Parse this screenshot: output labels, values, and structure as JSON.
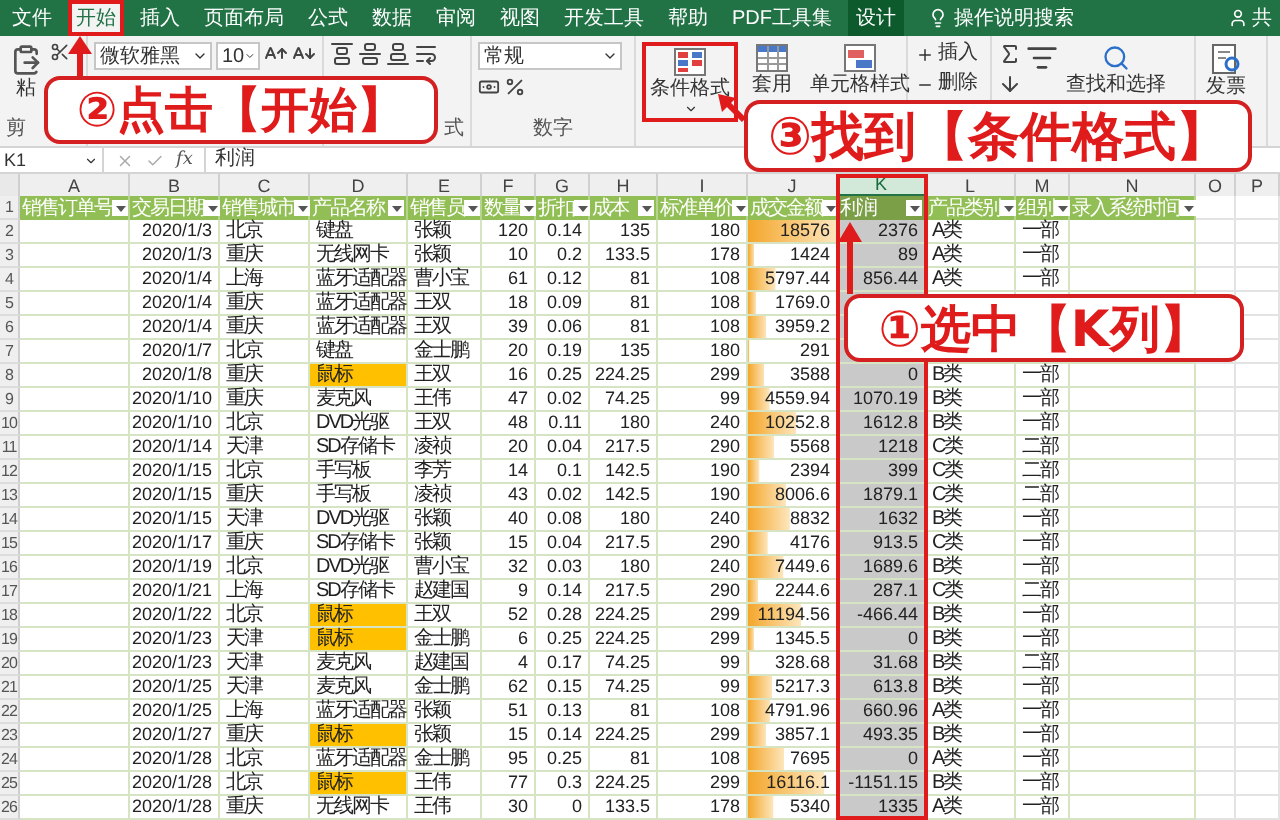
{
  "ribbon_tabs": [
    {
      "label": "文件",
      "kind": "tab",
      "selected": false
    },
    {
      "label": "开始",
      "kind": "tab",
      "selected": true
    },
    {
      "label": "插入",
      "kind": "tab",
      "selected": false
    },
    {
      "label": "页面布局",
      "kind": "tab",
      "selected": false
    },
    {
      "label": "公式",
      "kind": "tab",
      "selected": false
    },
    {
      "label": "数据",
      "kind": "tab",
      "selected": false
    },
    {
      "label": "审阅",
      "kind": "tab",
      "selected": false
    },
    {
      "label": "视图",
      "kind": "tab",
      "selected": false
    },
    {
      "label": "开发工具",
      "kind": "tab",
      "selected": false
    },
    {
      "label": "帮助",
      "kind": "tab",
      "selected": false
    },
    {
      "label": "PDF工具集",
      "kind": "tab",
      "selected": false
    },
    {
      "label": "设计",
      "kind": "context",
      "selected": false
    }
  ],
  "tell_me": "操作说明搜索",
  "share": "共",
  "ribbon": {
    "paste": "粘",
    "clipboard_group": "剪",
    "font_name": "微软雅黑",
    "font_size": "10",
    "alignment_group": "式",
    "number_format": "常规",
    "number_group": "数字",
    "conditional_format": "条件格式",
    "format_as_table": "套用",
    "cell_styles": "单元格样式",
    "insert": "插入",
    "delete": "删除",
    "find_select": "查找和选择",
    "invoice": "发票"
  },
  "formula_bar": {
    "name_box": "K1",
    "fx": "fx",
    "formula": "利润"
  },
  "columns": [
    {
      "label": "A",
      "selected": false
    },
    {
      "label": "B",
      "selected": false
    },
    {
      "label": "C",
      "selected": false
    },
    {
      "label": "D",
      "selected": false
    },
    {
      "label": "E",
      "selected": false
    },
    {
      "label": "F",
      "selected": false
    },
    {
      "label": "G",
      "selected": false
    },
    {
      "label": "H",
      "selected": false
    },
    {
      "label": "I",
      "selected": false
    },
    {
      "label": "J",
      "selected": false
    },
    {
      "label": "K",
      "selected": true
    },
    {
      "label": "L",
      "selected": false
    },
    {
      "label": "M",
      "selected": false
    },
    {
      "label": "N",
      "selected": false
    },
    {
      "label": "O",
      "selected": false
    },
    {
      "label": "P",
      "selected": false
    }
  ],
  "header_row_number": "1",
  "table_headers": [
    "销售订单号",
    "交易日期",
    "销售城市",
    "产品名称",
    "销售员",
    "数量",
    "折扣",
    "成本",
    "标准单价",
    "成交金额",
    "利润",
    "产品类别",
    "组别",
    "录入系统时间"
  ],
  "rows": [
    {
      "number": "2",
      "product_highlighted": false,
      "cells": [
        "2020/1/3",
        "北京",
        "键盘",
        "张颖",
        "120",
        "0.14",
        "135",
        "180",
        "18576",
        "2376",
        "A类",
        "一部"
      ]
    },
    {
      "number": "3",
      "product_highlighted": false,
      "cells": [
        "2020/1/3",
        "重庆",
        "无线网卡",
        "张颖",
        "10",
        "0.2",
        "133.5",
        "178",
        "1424",
        "89",
        "A类",
        "一部"
      ]
    },
    {
      "number": "4",
      "product_highlighted": false,
      "cells": [
        "2020/1/4",
        "上海",
        "蓝牙适配器",
        "曹小宝",
        "61",
        "0.12",
        "81",
        "108",
        "5797.44",
        "856.44",
        "A类",
        "一部"
      ]
    },
    {
      "number": "5",
      "product_highlighted": false,
      "cells": [
        "2020/1/4",
        "重庆",
        "蓝牙适配器",
        "王双",
        "18",
        "0.09",
        "81",
        "108",
        "1769.0"
      ]
    },
    {
      "number": "6",
      "product_highlighted": false,
      "cells": [
        "2020/1/4",
        "重庆",
        "蓝牙适配器",
        "王双",
        "39",
        "0.06",
        "81",
        "108",
        "3959.2"
      ]
    },
    {
      "number": "7",
      "product_highlighted": false,
      "cells": [
        "2020/1/7",
        "北京",
        "键盘",
        "金士鹏",
        "20",
        "0.19",
        "135",
        "180",
        "291"
      ]
    },
    {
      "number": "8",
      "product_highlighted": true,
      "cells": [
        "2020/1/8",
        "重庆",
        "鼠标",
        "王双",
        "16",
        "0.25",
        "224.25",
        "299",
        "3588",
        "0",
        "B类",
        "一部"
      ]
    },
    {
      "number": "9",
      "product_highlighted": false,
      "cells": [
        "2020/1/10",
        "重庆",
        "麦克风",
        "王伟",
        "47",
        "0.02",
        "74.25",
        "99",
        "4559.94",
        "1070.19",
        "B类",
        "一部"
      ]
    },
    {
      "number": "10",
      "product_highlighted": false,
      "cells": [
        "2020/1/10",
        "北京",
        "DVD光驱",
        "王双",
        "48",
        "0.11",
        "180",
        "240",
        "10252.8",
        "1612.8",
        "B类",
        "一部"
      ]
    },
    {
      "number": "11",
      "product_highlighted": false,
      "cells": [
        "2020/1/14",
        "天津",
        "SD存储卡",
        "凌祯",
        "20",
        "0.04",
        "217.5",
        "290",
        "5568",
        "1218",
        "C类",
        "二部"
      ]
    },
    {
      "number": "12",
      "product_highlighted": false,
      "cells": [
        "2020/1/15",
        "北京",
        "手写板",
        "李芳",
        "14",
        "0.1",
        "142.5",
        "190",
        "2394",
        "399",
        "C类",
        "二部"
      ]
    },
    {
      "number": "13",
      "product_highlighted": false,
      "cells": [
        "2020/1/15",
        "重庆",
        "手写板",
        "凌祯",
        "43",
        "0.02",
        "142.5",
        "190",
        "8006.6",
        "1879.1",
        "C类",
        "二部"
      ]
    },
    {
      "number": "14",
      "product_highlighted": false,
      "cells": [
        "2020/1/15",
        "天津",
        "DVD光驱",
        "张颖",
        "40",
        "0.08",
        "180",
        "240",
        "8832",
        "1632",
        "B类",
        "一部"
      ]
    },
    {
      "number": "15",
      "product_highlighted": false,
      "cells": [
        "2020/1/17",
        "重庆",
        "SD存储卡",
        "张颖",
        "15",
        "0.04",
        "217.5",
        "290",
        "4176",
        "913.5",
        "C类",
        "一部"
      ]
    },
    {
      "number": "16",
      "product_highlighted": false,
      "cells": [
        "2020/1/19",
        "北京",
        "DVD光驱",
        "曹小宝",
        "32",
        "0.03",
        "180",
        "240",
        "7449.6",
        "1689.6",
        "B类",
        "一部"
      ]
    },
    {
      "number": "17",
      "product_highlighted": false,
      "cells": [
        "2020/1/21",
        "上海",
        "SD存储卡",
        "赵建国",
        "9",
        "0.14",
        "217.5",
        "290",
        "2244.6",
        "287.1",
        "C类",
        "二部"
      ]
    },
    {
      "number": "18",
      "product_highlighted": true,
      "cells": [
        "2020/1/22",
        "北京",
        "鼠标",
        "王双",
        "52",
        "0.28",
        "224.25",
        "299",
        "11194.56",
        "-466.44",
        "B类",
        "一部"
      ]
    },
    {
      "number": "19",
      "product_highlighted": true,
      "cells": [
        "2020/1/23",
        "天津",
        "鼠标",
        "金士鹏",
        "6",
        "0.25",
        "224.25",
        "299",
        "1345.5",
        "0",
        "B类",
        "一部"
      ]
    },
    {
      "number": "20",
      "product_highlighted": false,
      "cells": [
        "2020/1/23",
        "天津",
        "麦克风",
        "赵建国",
        "4",
        "0.17",
        "74.25",
        "99",
        "328.68",
        "31.68",
        "B类",
        "二部"
      ]
    },
    {
      "number": "21",
      "product_highlighted": false,
      "cells": [
        "2020/1/25",
        "天津",
        "麦克风",
        "金士鹏",
        "62",
        "0.15",
        "74.25",
        "99",
        "5217.3",
        "613.8",
        "B类",
        "一部"
      ]
    },
    {
      "number": "22",
      "product_highlighted": false,
      "cells": [
        "2020/1/25",
        "上海",
        "蓝牙适配器",
        "张颖",
        "51",
        "0.13",
        "81",
        "108",
        "4791.96",
        "660.96",
        "A类",
        "一部"
      ]
    },
    {
      "number": "23",
      "product_highlighted": true,
      "cells": [
        "2020/1/27",
        "重庆",
        "鼠标",
        "张颖",
        "15",
        "0.14",
        "224.25",
        "299",
        "3857.1",
        "493.35",
        "B类",
        "一部"
      ]
    },
    {
      "number": "24",
      "product_highlighted": false,
      "cells": [
        "2020/1/28",
        "北京",
        "蓝牙适配器",
        "金士鹏",
        "95",
        "0.25",
        "81",
        "108",
        "7695",
        "0",
        "A类",
        "一部"
      ]
    },
    {
      "number": "25",
      "product_highlighted": true,
      "cells": [
        "2020/1/28",
        "北京",
        "鼠标",
        "王伟",
        "77",
        "0.3",
        "224.25",
        "299",
        "16116.1",
        "-1151.15",
        "B类",
        "一部"
      ]
    },
    {
      "number": "26",
      "product_highlighted": false,
      "cells": [
        "2020/1/28",
        "重庆",
        "无线网卡",
        "王伟",
        "30",
        "0",
        "133.5",
        "178",
        "5340",
        "1335",
        "A类",
        "一部"
      ]
    }
  ],
  "annotations": [
    {
      "kind": "click_tab",
      "text": "②点击【开始】"
    },
    {
      "kind": "find_button",
      "text": "③找到【条件格式】"
    },
    {
      "kind": "select_column",
      "text": "①选中【K列】"
    }
  ]
}
